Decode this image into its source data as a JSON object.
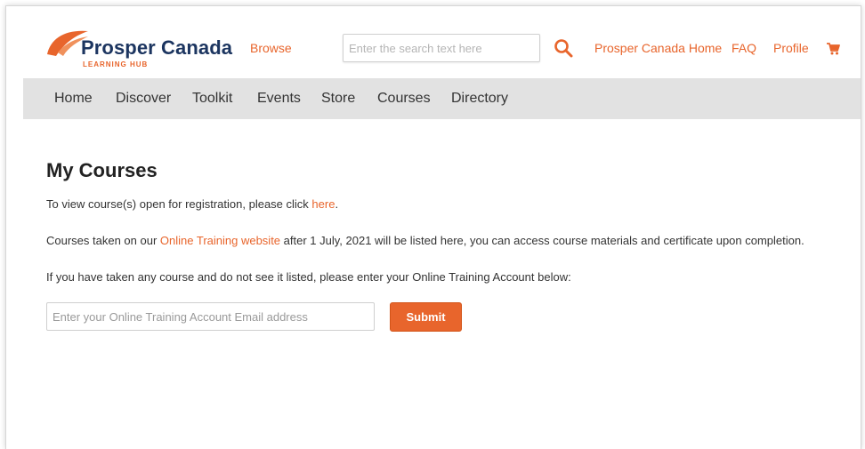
{
  "header": {
    "logo_title": "Prosper Canada",
    "logo_subtitle": "LEARNING HUB",
    "browse_label": "Browse",
    "search_placeholder": "Enter the search text here",
    "links": {
      "home": "Prosper Canada Home",
      "faq": "FAQ",
      "profile": "Profile"
    }
  },
  "nav": {
    "items": [
      "Home",
      "Discover",
      "Toolkit",
      "Events",
      "Store",
      "Courses",
      "Directory"
    ]
  },
  "main": {
    "title": "My Courses",
    "line1": {
      "before": "To view course(s) open for registration, please click ",
      "link": "here",
      "after": "."
    },
    "line2": {
      "before": "Courses taken on our ",
      "link": "Online Training website",
      "after": " after 1 July, 2021 will be listed here, you can access course materials and certificate upon completion."
    },
    "line3": "If you have taken any course and do not see it listed, please enter your Online Training Account below:",
    "email_placeholder": "Enter your Online Training Account Email address",
    "submit_label": "Submit"
  },
  "colors": {
    "accent": "#e8652c",
    "brand_navy": "#1c3560",
    "nav_bg": "#e2e2e2"
  },
  "icons": {
    "search": "search-icon",
    "cart": "cart-icon",
    "logo_leaf": "leaf-logo-icon"
  }
}
